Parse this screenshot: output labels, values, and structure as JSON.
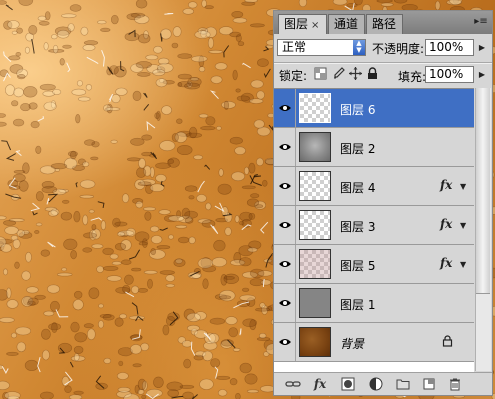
{
  "panel": {
    "tabs": [
      {
        "label": "图层",
        "active": true,
        "close": "×"
      },
      {
        "label": "通道",
        "active": false
      },
      {
        "label": "路径",
        "active": false
      }
    ],
    "menu_glyph": "▸≡"
  },
  "controls": {
    "blend_mode": "正常",
    "opacity_label": "不透明度:",
    "opacity_value": "100%",
    "lock_label": "锁定:",
    "fill_label": "填充:",
    "fill_value": "100%"
  },
  "layers": [
    {
      "name": "图层 6",
      "selected": true,
      "thumbnail": "transparent",
      "fx": false,
      "locked": false
    },
    {
      "name": "图层 2",
      "selected": false,
      "thumbnail": "gray-blur",
      "fx": false,
      "locked": false
    },
    {
      "name": "图层 4",
      "selected": false,
      "thumbnail": "transparent",
      "fx": true,
      "locked": false
    },
    {
      "name": "图层 3",
      "selected": false,
      "thumbnail": "transparent",
      "fx": true,
      "locked": false
    },
    {
      "name": "图层 5",
      "selected": false,
      "thumbnail": "transparent-pink",
      "fx": true,
      "locked": false
    },
    {
      "name": "图层 1",
      "selected": false,
      "thumbnail": "gray",
      "fx": false,
      "locked": false
    },
    {
      "name": "背景",
      "selected": false,
      "thumbnail": "brown",
      "fx": false,
      "locked": true
    }
  ],
  "fx_label": "fx",
  "icons": {
    "lock_transparent": "checker-lock-icon",
    "lock_brush": "brush-lock-icon",
    "lock_move": "move-lock-icon",
    "lock_all": "padlock-icon",
    "bottom": [
      "link-icon",
      "fx-icon",
      "mask-icon",
      "adjustment-icon",
      "folder-icon",
      "new-layer-icon",
      "trash-icon"
    ]
  },
  "colors": {
    "selected_row": "#3f6fc4",
    "canvas_base": "#c47a1e"
  }
}
